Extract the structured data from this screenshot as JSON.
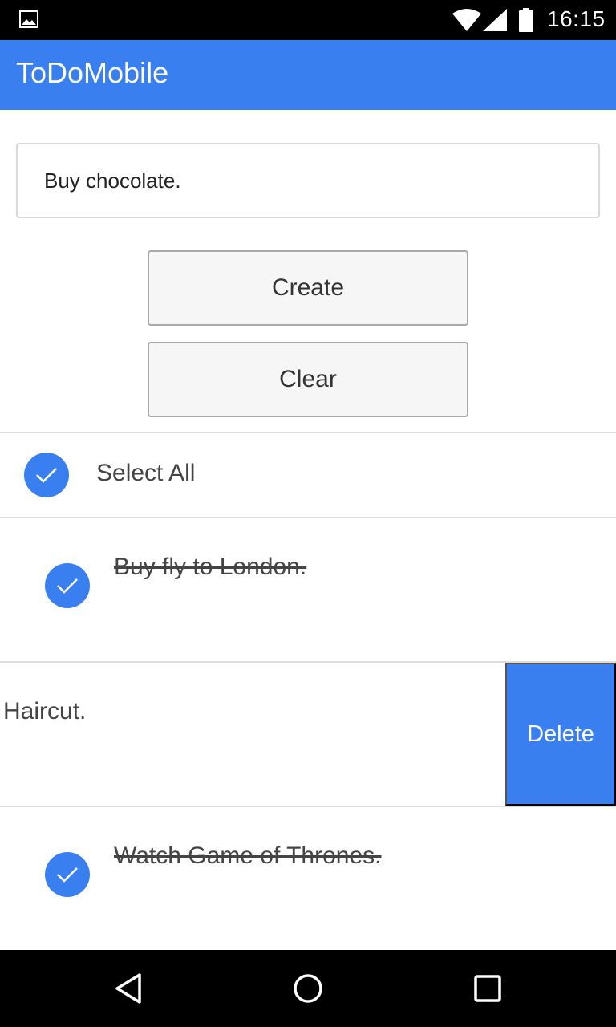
{
  "status_bar": {
    "time": "16:15",
    "icons": [
      "gallery-icon",
      "wifi-icon",
      "signal-icon",
      "battery-icon"
    ]
  },
  "app_bar": {
    "title": "ToDoMobile"
  },
  "form": {
    "input_value": "Buy chocolate.",
    "create_label": "Create",
    "clear_label": "Clear"
  },
  "select_all": {
    "label": "Select All",
    "checked": true
  },
  "todos": [
    {
      "text": "Buy fly to London.",
      "completed": true
    },
    {
      "text": "Haircut.",
      "completed": false,
      "swiped_action": "Delete"
    },
    {
      "text": "Watch Game of Thrones.",
      "completed": true
    }
  ],
  "nav_bar": {
    "icons": [
      "back-icon",
      "home-icon",
      "recents-icon"
    ]
  },
  "colors": {
    "accent": "#3a7ff0",
    "status_bar": "#000000",
    "divider": "#dddddd"
  }
}
